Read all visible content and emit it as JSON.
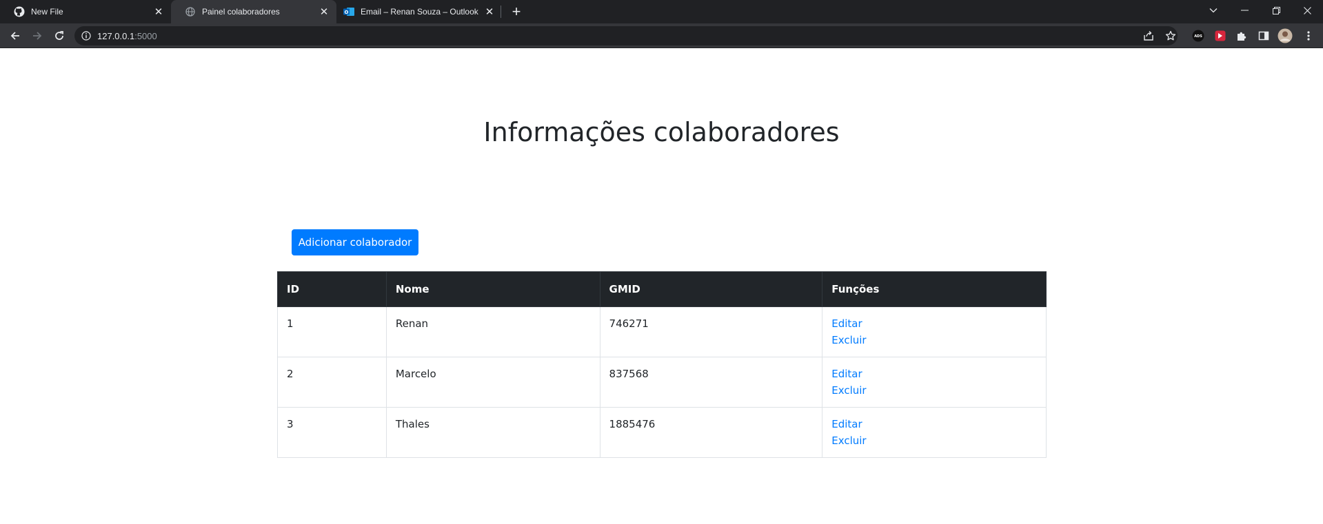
{
  "browser": {
    "tabs": [
      {
        "title": "New File",
        "icon": "github-icon",
        "active": false
      },
      {
        "title": "Painel colaboradores",
        "icon": "globe-icon",
        "active": true
      },
      {
        "title": "Email – Renan Souza – Outlook",
        "icon": "outlook-icon",
        "active": false
      }
    ],
    "address": {
      "host": "127.0.0.1",
      "port": ":5000"
    },
    "extensions": [
      "ads-extension-icon",
      "red-extension-icon",
      "puzzle-icon",
      "side-panel-icon",
      "profile-avatar",
      "kebab-menu-icon"
    ]
  },
  "page": {
    "title": "Informações colaboradores",
    "add_button": "Adicionar colaborador",
    "table": {
      "headers": {
        "id": "ID",
        "nome": "Nome",
        "gmid": "GMID",
        "funcoes": "Funções"
      },
      "rows": [
        {
          "id": "1",
          "nome": "Renan",
          "gmid": "746271",
          "edit": "Editar",
          "delete": "Excluir"
        },
        {
          "id": "2",
          "nome": "Marcelo",
          "gmid": "837568",
          "edit": "Editar",
          "delete": "Excluir"
        },
        {
          "id": "3",
          "nome": "Thales",
          "gmid": "1885476",
          "edit": "Editar",
          "delete": "Excluir"
        }
      ]
    }
  },
  "colors": {
    "primary": "#007bff",
    "header_bg": "#212529",
    "chrome_bg": "#202124",
    "toolbar_bg": "#35363a"
  }
}
